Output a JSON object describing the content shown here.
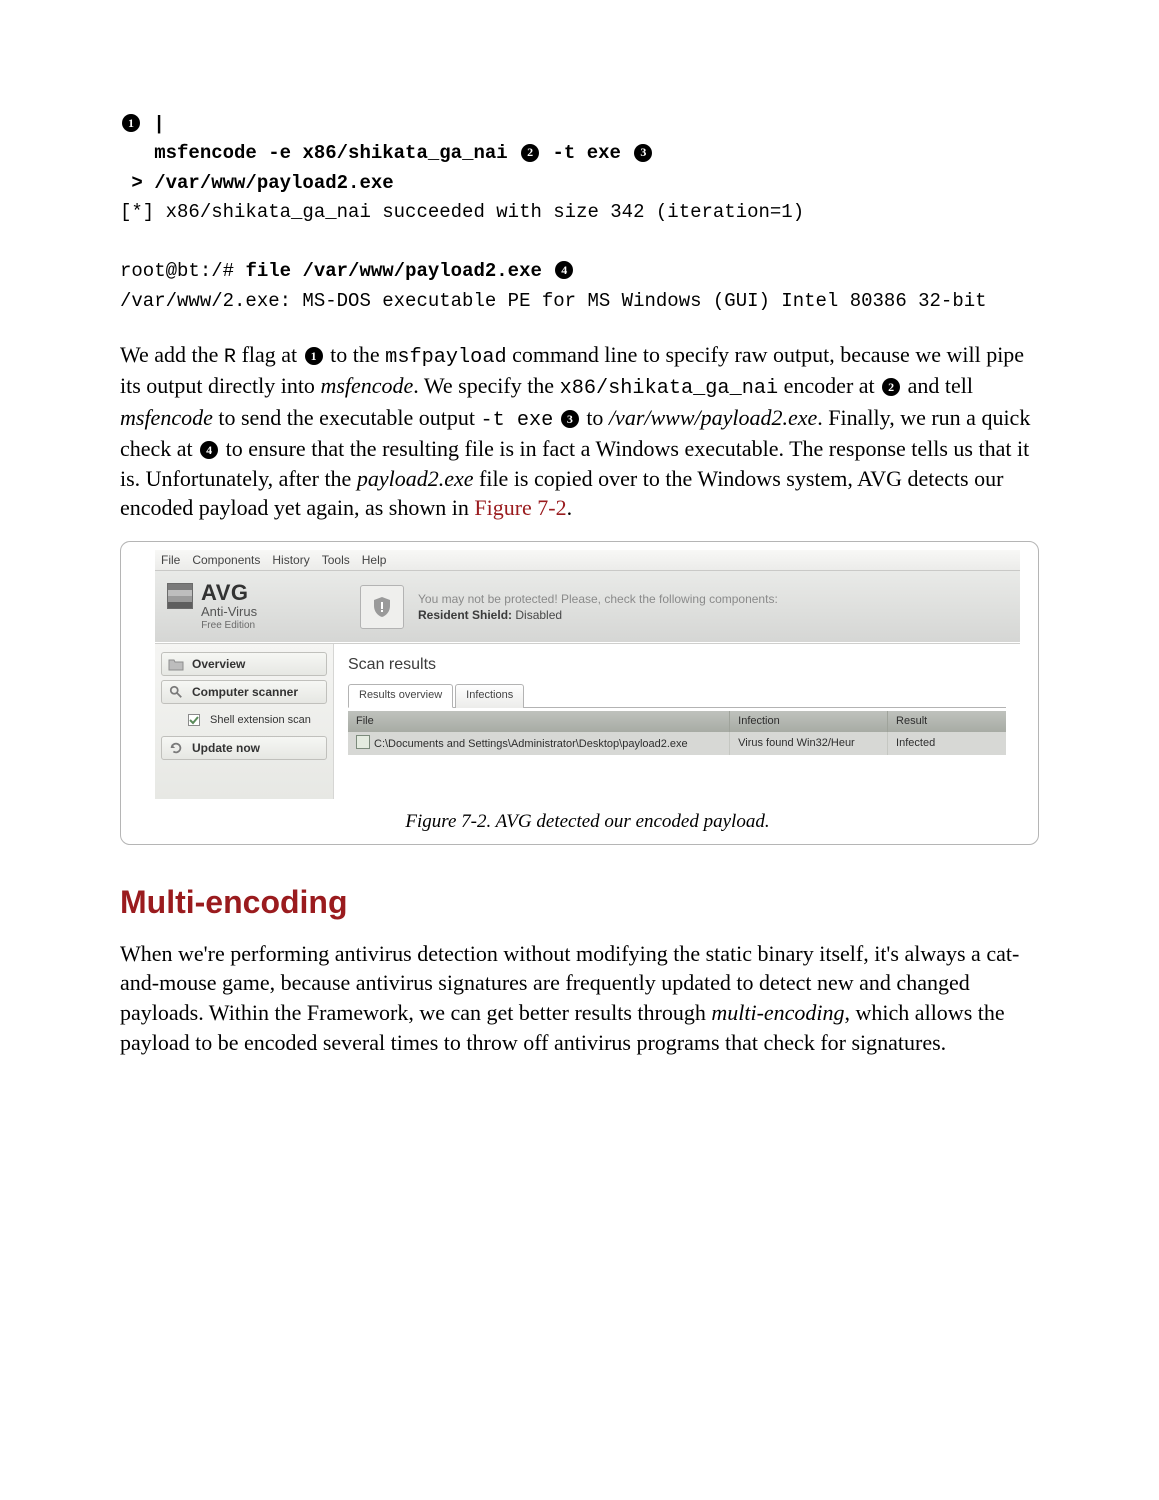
{
  "callouts": {
    "c1": "1",
    "c2": "2",
    "c3": "3",
    "c4": "4"
  },
  "code": {
    "line1_pipe": "|",
    "line2_cmd": "msfencode -e x86/shikata_ga_nai",
    "line2_opt": "-t exe",
    "line3": "> /var/www/payload2.exe",
    "line4": "[*] x86/shikata_ga_nai succeeded with size 342 (iteration=1)",
    "blank": "",
    "line6_prompt": "root@bt:/#",
    "line6_cmd": "file /var/www/payload2.exe",
    "line7": "/var/www/2.exe: MS-DOS executable PE for MS Windows (GUI) Intel 80386 32-bit"
  },
  "para1": {
    "t1": "We add the ",
    "r_flag": "R",
    "t2": " flag at ",
    "t3": " to the ",
    "msfpayload": "msfpayload",
    "t4": " command line to specify raw output, because we will pipe its output directly into ",
    "msfencode": "msfencode",
    "t5": ". We specify the ",
    "encoder": "x86/shikata_ga_nai",
    "t6": " encoder at ",
    "t7": " and tell ",
    "t8": " to send the executable output ",
    "texe": "-t exe",
    "t9": " to ",
    "path": "/var/www/payload2.exe",
    "t10": ". Finally, we run a quick check at ",
    "t11": " to ensure that the resulting file is in fact a Windows executable. The response tells us that it is. Unfortunately, after the ",
    "payload2": "payload2.exe",
    "t12": " file is copied over to the Windows system, AVG detects our encoded payload yet again, as shown in ",
    "figref": "Figure 7-2",
    "t13": "."
  },
  "figure": {
    "caption": "Figure 7-2. AVG detected our encoded payload.",
    "avg": {
      "menu": [
        "File",
        "Components",
        "History",
        "Tools",
        "Help"
      ],
      "brand": {
        "name": "AVG",
        "product": "Anti-Virus",
        "edition": "Free Edition"
      },
      "warn_line1": "You may not be protected! Please, check the following components:",
      "warn_line2_label": "Resident Shield:",
      "warn_line2_value": "Disabled",
      "sidebar": {
        "overview": "Overview",
        "scanner": "Computer scanner",
        "shell": "Shell extension scan",
        "update": "Update now"
      },
      "main_title": "Scan results",
      "tabs": {
        "results": "Results overview",
        "infections": "Infections"
      },
      "table": {
        "headers": {
          "file": "File",
          "infection": "Infection",
          "result": "Result"
        },
        "row": {
          "file": "C:\\Documents and Settings\\Administrator\\Desktop\\payload2.exe",
          "infection": "Virus found Win32/Heur",
          "result": "Infected"
        }
      }
    }
  },
  "section_heading": "Multi-encoding",
  "para2": {
    "t1": "When we're performing antivirus detection without modifying the static binary itself, it's always a cat-and-mouse game, because antivirus signatures are frequently updated to detect new and changed payloads. Within the Framework, we can get better results through ",
    "multi": "multi-encoding",
    "t2": ", which allows the payload to be encoded several times to throw off antivirus programs that check for signatures."
  }
}
